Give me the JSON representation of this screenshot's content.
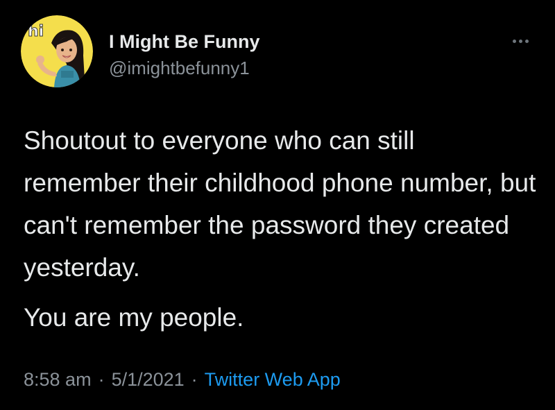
{
  "tweet": {
    "author": {
      "display_name": "I Might Be Funny",
      "handle": "@imightbefunny1",
      "avatar_icon": "bitmoji-avatar-waving",
      "avatar_caption": "hi",
      "avatar_bg": "#f4de4c"
    },
    "more_icon": "more-dots-icon",
    "text": {
      "paragraph1": "Shoutout to everyone who can still remember their childhood phone number, but can't remember the password they created yesterday.",
      "paragraph2": "You are my people."
    },
    "meta": {
      "time": "8:58 am",
      "date": "5/1/2021",
      "separator": "·",
      "source": "Twitter Web App"
    }
  },
  "colors": {
    "background": "#000000",
    "text": "#e7e9ea",
    "secondary": "#8b9299",
    "link": "#1d9bf0"
  }
}
